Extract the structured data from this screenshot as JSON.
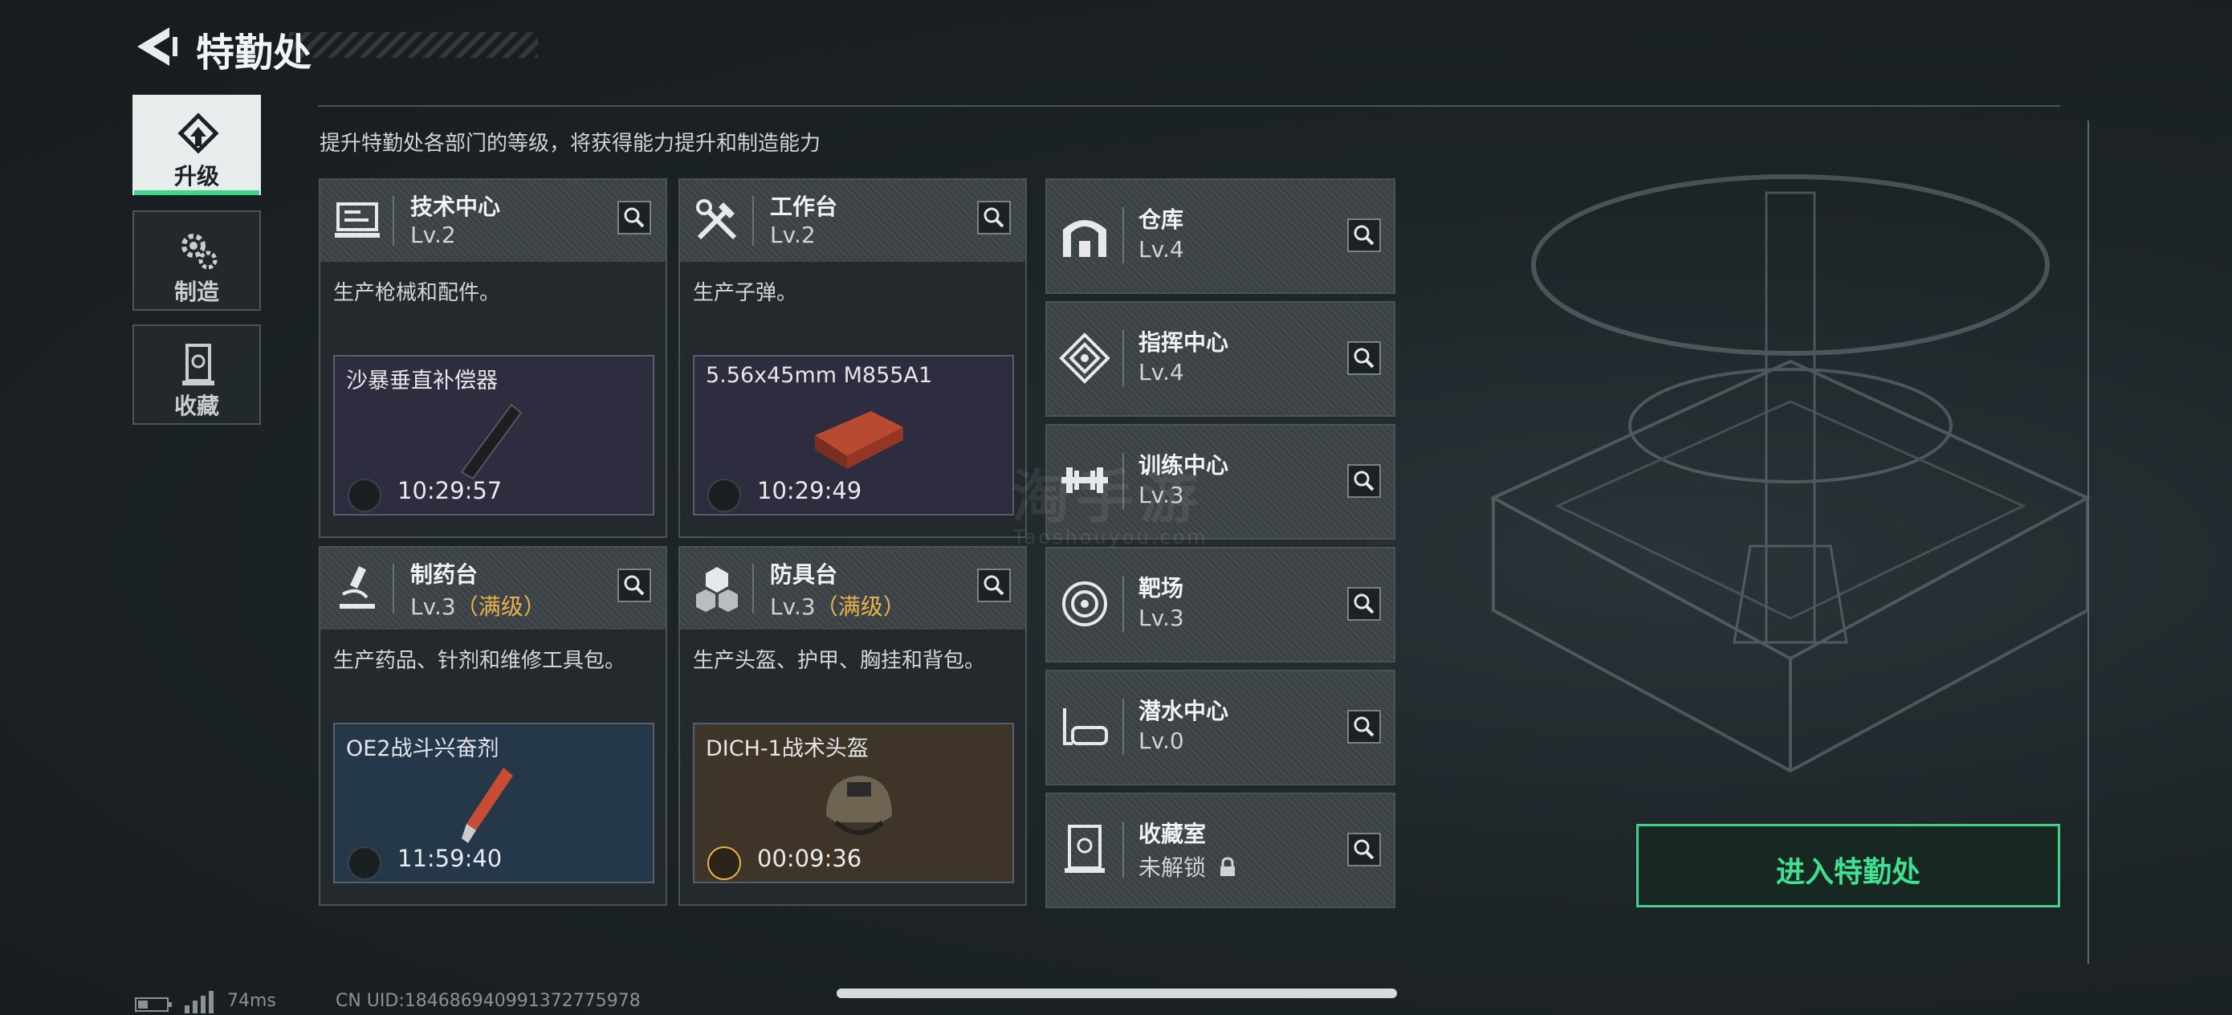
{
  "header": {
    "title": "特勤处"
  },
  "tabs": [
    {
      "label": "升级",
      "icon": "upgrade-icon",
      "active": true
    },
    {
      "label": "制造",
      "icon": "gears-icon",
      "active": false
    },
    {
      "label": "收藏",
      "icon": "collection-icon",
      "active": false
    }
  ],
  "description": "提升特勤处各部门的等级，将获得能力提升和制造能力",
  "cards": [
    {
      "name": "技术中心",
      "level": "Lv.2",
      "max": "",
      "desc": "生产枪械和配件。",
      "item": "沙暴垂直补偿器",
      "time": "10:29:57",
      "slot_bg": "#2e2d40"
    },
    {
      "name": "工作台",
      "level": "Lv.2",
      "max": "",
      "desc": "生产子弹。",
      "item": "5.56x45mm M855A1",
      "time": "10:29:49",
      "slot_bg": "#2e2d40"
    },
    {
      "name": "制药台",
      "level": "Lv.3",
      "max": "（满级）",
      "desc": "生产药品、针剂和维修工具包。",
      "item": "OE2战斗兴奋剂",
      "time": "11:59:40",
      "slot_bg": "#24384a"
    },
    {
      "name": "防具台",
      "level": "Lv.3",
      "max": "（满级）",
      "desc": "生产头盔、护甲、胸挂和背包。",
      "item": "DICH-1战术头盔",
      "time": "00:09:36",
      "slot_bg": "#3e3428"
    }
  ],
  "facilities": [
    {
      "name": "仓库",
      "level": "Lv.4",
      "icon": "warehouse-icon"
    },
    {
      "name": "指挥中心",
      "level": "Lv.4",
      "icon": "command-center-icon"
    },
    {
      "name": "训练中心",
      "level": "Lv.3",
      "icon": "dumbbell-icon"
    },
    {
      "name": "靶场",
      "level": "Lv.3",
      "icon": "target-icon"
    },
    {
      "name": "潜水中心",
      "level": "Lv.0",
      "icon": "diving-mask-icon"
    },
    {
      "name": "收藏室",
      "level": "未解锁",
      "icon": "vault-icon"
    }
  ],
  "enter_button": "进入特勤处",
  "watermark": {
    "main": "淘手游",
    "sub": "Taoshouyou.com"
  },
  "status": {
    "ping": "74ms",
    "uid": "CN UID:18468694099137​2775978"
  },
  "colors": {
    "accent_green": "#3fd48a",
    "max_level_gold": "#e8b34a"
  }
}
